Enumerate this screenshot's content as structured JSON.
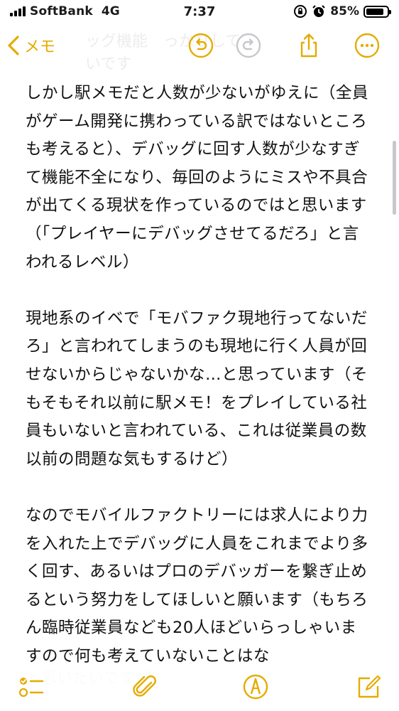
{
  "status_bar": {
    "carrier": "SoftBank",
    "network": "4G",
    "time": "7:37",
    "battery_percent_label": "85%",
    "battery_level": 0.85
  },
  "toolbar": {
    "back_label": "メモ",
    "accent_color": "#e5ab00",
    "icons": [
      "undo-icon",
      "redo-icon",
      "share-icon",
      "more-icon"
    ]
  },
  "note": {
    "paragraphs": [
      "しかし駅メモだと人数が少ないがゆえに（全員がゲーム開発に携わっている訳ではないところも考えると）、デバッグに回す人数が少なすぎて機能不全になり、毎回のようにミスや不具合が出てくる現状を作っているのではと思います（「プレイヤーにデバッグさせてるだろ」と言われるレベル）",
      "現地系のイベで「モバファク現地行ってないだろ」と言われてしまうのも現地に行く人員が回せないからじゃないかな…と思っています（そもそもそれ以前に駅メモ！をプレイしている社員もいないと言われている、これは従業員の数以前の問題な気もするけど）",
      "なのでモバイルファクトリーには求人により力を入れた上でデバッグに人員をこれまでより多く回す、あるいはプロのデバッガーを繋ぎ止めるという努力をしてほしいと願います（もちろん臨時従業員なども20人ほどいらっしゃいますので何も考えていないことはな"
    ],
    "ghost_line_top": "ッグ機能　っかりして",
    "ghost_line_top2": "いです",
    "ghost_line_bottom": "と思いたいですが）"
  },
  "bottom_toolbar": {
    "icons": [
      "checklist-icon",
      "attachment-icon",
      "markup-icon",
      "compose-icon"
    ]
  }
}
